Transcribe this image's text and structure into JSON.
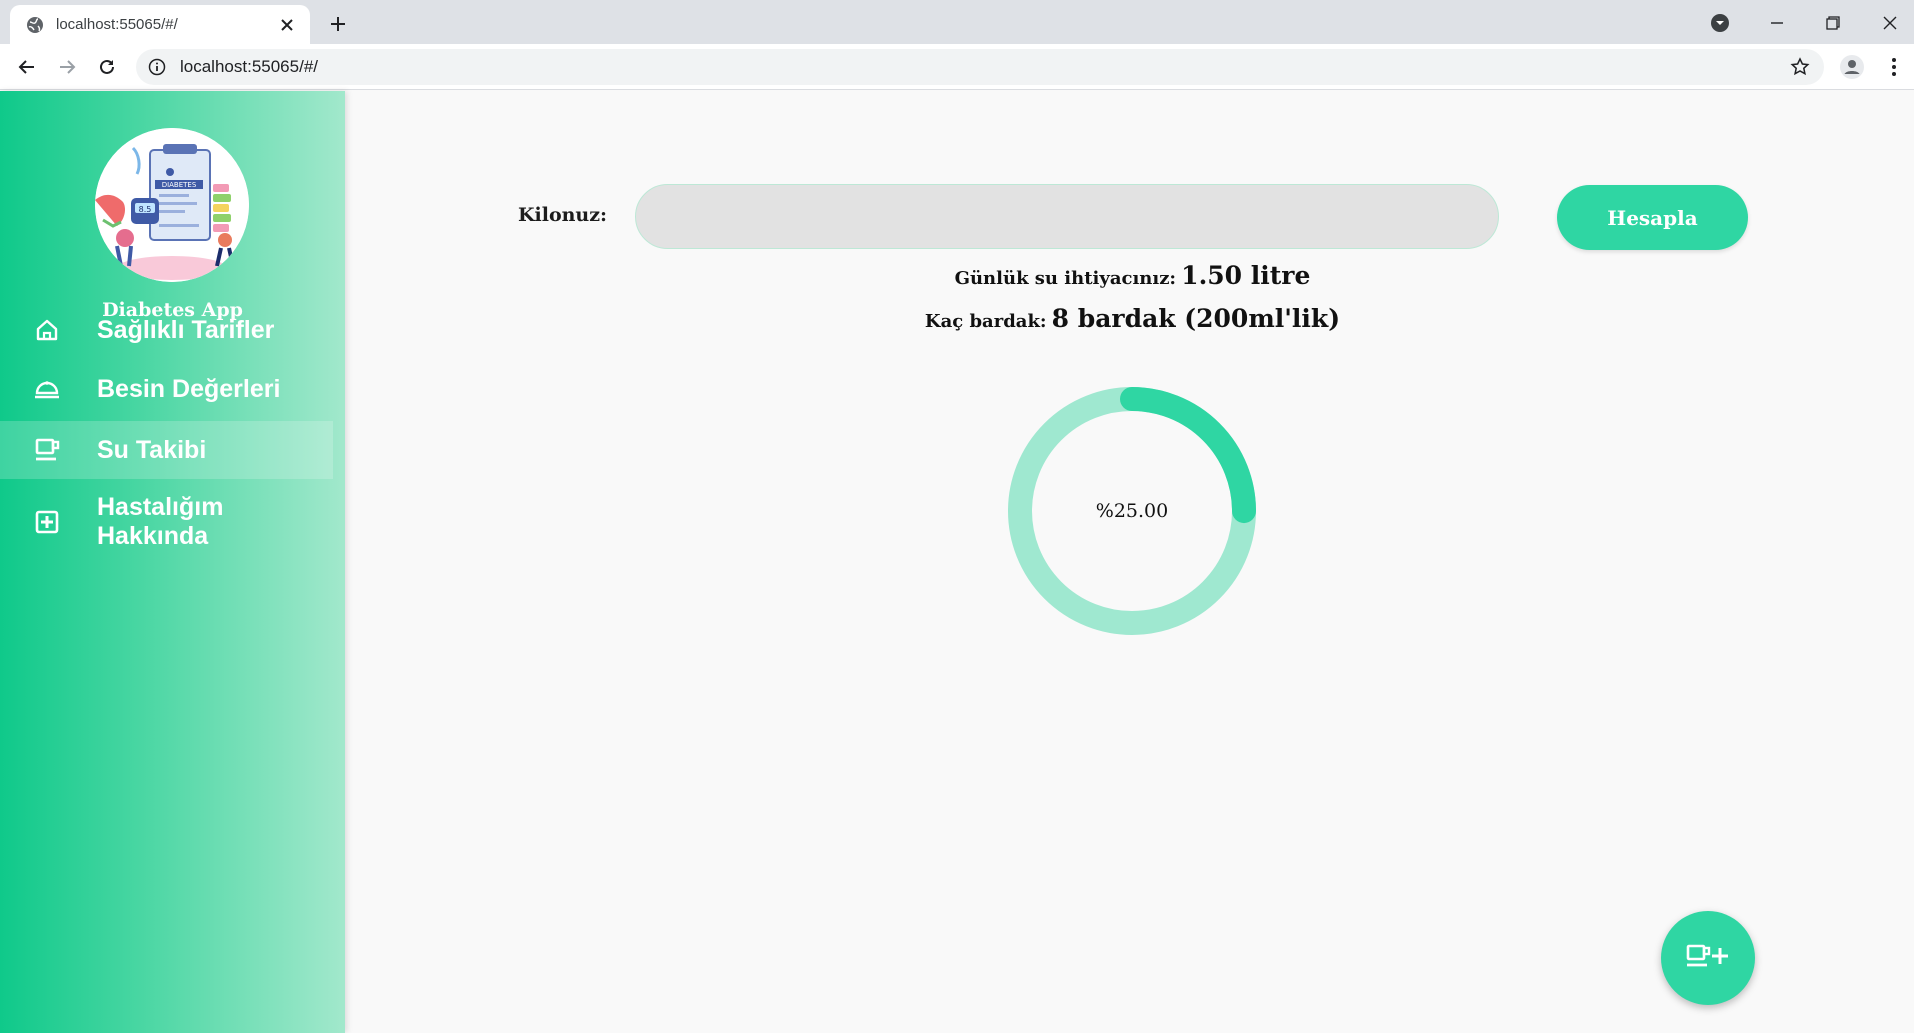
{
  "browser": {
    "tab_title": "localhost:55065/#/",
    "url": "localhost:55065/#/"
  },
  "sidebar": {
    "app_name": "Diabetes App",
    "logo_text": "DIABETES",
    "items": [
      {
        "label": "Sağlıklı Tarifler",
        "icon": "home-icon",
        "active": false
      },
      {
        "label": "Besin Değerleri",
        "icon": "food-tray-icon",
        "active": false
      },
      {
        "label": "Su Takibi",
        "icon": "cup-icon",
        "active": true
      },
      {
        "label": "Hastalığım Hakkında",
        "icon": "medical-plus-icon",
        "active": false
      }
    ]
  },
  "main": {
    "weight_label": "Kilonuz:",
    "weight_value": "",
    "calculate_label": "Hesapla",
    "daily_label": "Günlük su ihtiyacınız:",
    "daily_value": "1.50 litre",
    "glasses_label": "Kaç bardak:",
    "glasses_value": "8 bardak (200ml'lik)",
    "progress_text": "%25.00",
    "progress_fraction": 0.25
  },
  "colors": {
    "accent": "#2fd6a3",
    "ring_track": "#9fe8d0",
    "sidebar_start": "#0fc98a",
    "sidebar_end": "#a2e8cc"
  }
}
